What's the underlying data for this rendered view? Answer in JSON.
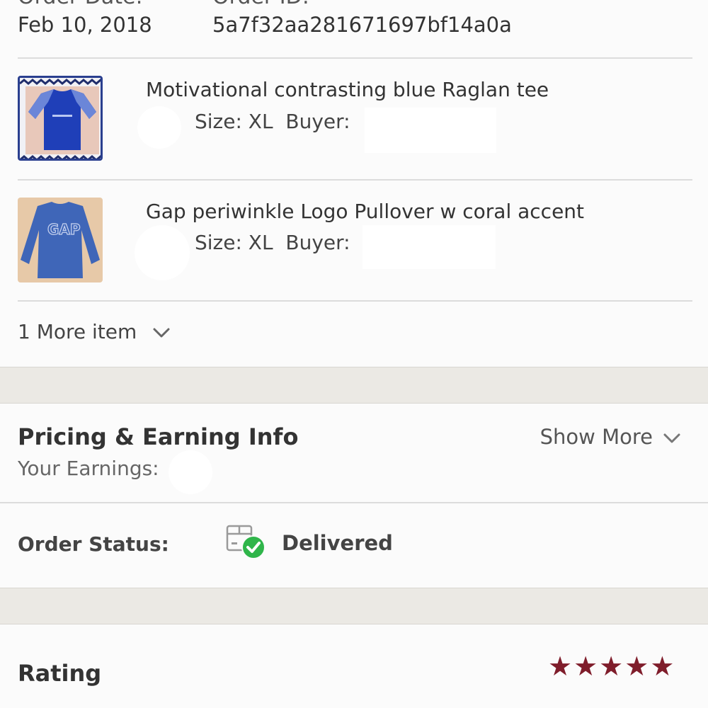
{
  "order": {
    "date_label": "Order Date:",
    "id_label": "Order ID:",
    "date": "Feb 10, 2018",
    "id": "5a7f32aa281671697bf14a0a"
  },
  "items": [
    {
      "title": "Motivational contrasting blue Raglan tee",
      "size": "Size: XL",
      "buyer_label": "Buyer:"
    },
    {
      "title": "Gap periwinkle Logo Pullover w coral accent",
      "size": "Size: XL",
      "buyer_label": "Buyer:"
    }
  ],
  "more_items": "1 More item",
  "pricing": {
    "title": "Pricing & Earning Info",
    "show_more": "Show More",
    "earnings_label": "Your Earnings:"
  },
  "status": {
    "label": "Order Status:",
    "value": "Delivered"
  },
  "rating": {
    "title": "Rating",
    "stars": 5,
    "star_color": "#7f1d2b"
  },
  "colors": {
    "accent_green": "#2fb54a",
    "band": "#ebe9e4"
  },
  "icons": {
    "status": "package-check-icon",
    "chevron": "chevron-down-icon",
    "star": "star-icon"
  }
}
